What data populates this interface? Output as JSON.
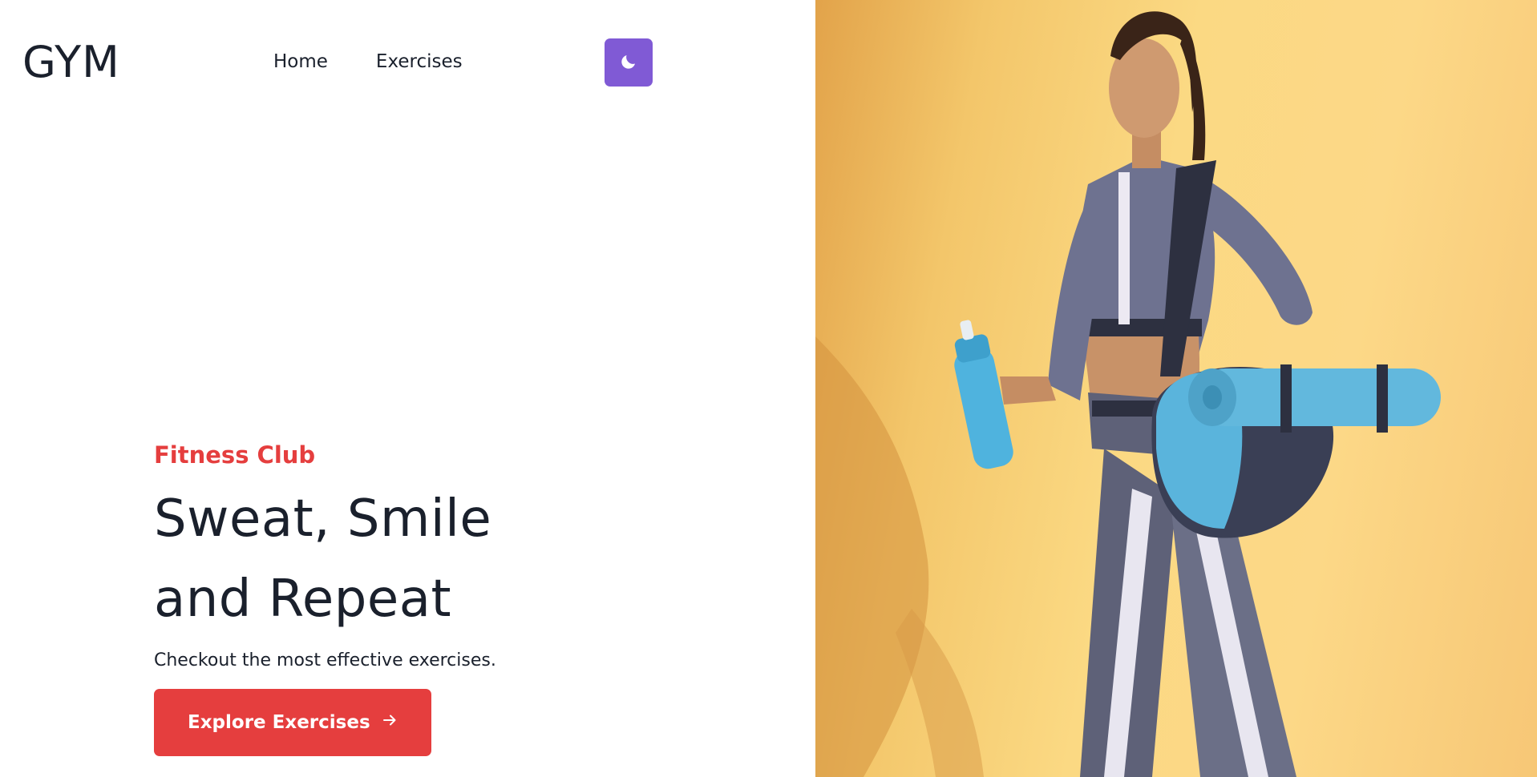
{
  "header": {
    "logo": "GYM",
    "nav": [
      {
        "label": "Home"
      },
      {
        "label": "Exercises"
      }
    ],
    "theme_toggle_icon": "moon-icon"
  },
  "hero": {
    "eyebrow": "Fitness Club",
    "headline_line1": "Sweat, Smile",
    "headline_line2": "and Repeat",
    "subtext": "Checkout the most effective exercises.",
    "cta_label": "Explore Exercises",
    "cta_icon": "arrow-right-icon"
  },
  "colors": {
    "accent": "#e53e3e",
    "toggle": "#805ad5",
    "text": "#1a202c",
    "photo_background": "#fbd983"
  },
  "image": {
    "icon": "fitness-woman-photo"
  }
}
